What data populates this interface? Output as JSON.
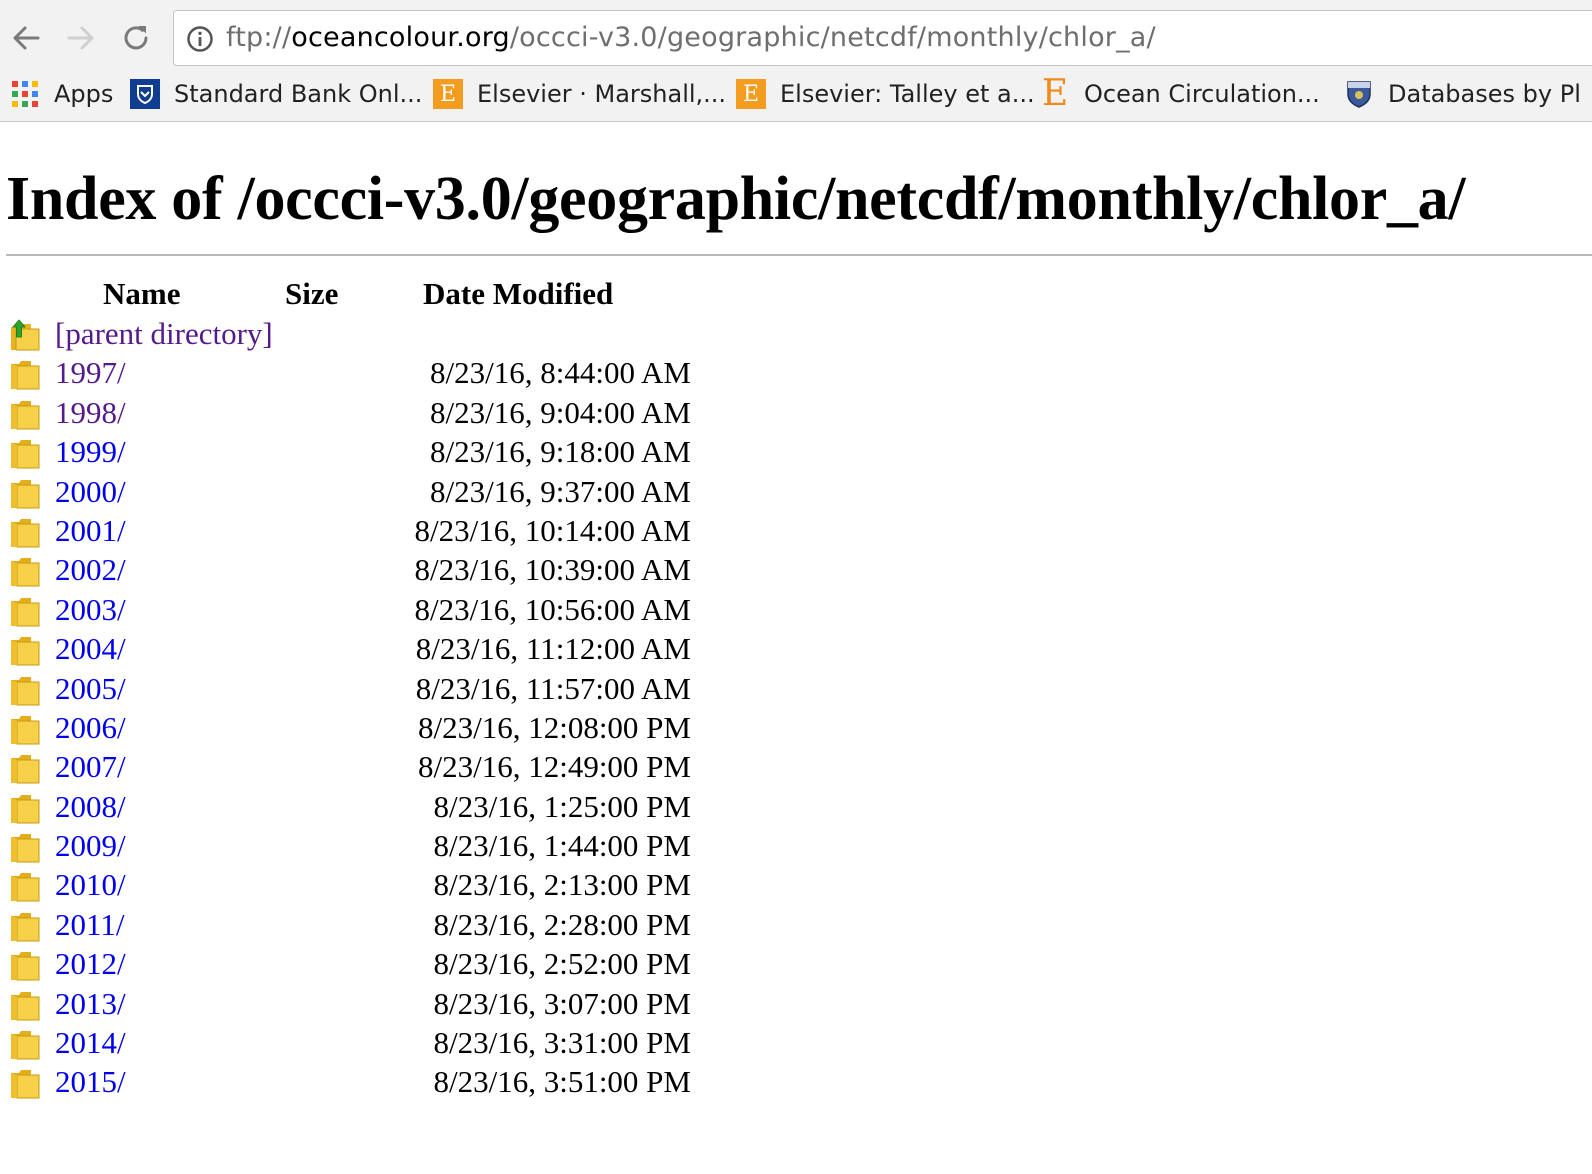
{
  "browser": {
    "url": {
      "scheme": "ftp://",
      "host": "oceancolour.org",
      "path": "/occci-v3.0/geographic/netcdf/monthly/chlor_a/"
    },
    "bookmarks": [
      {
        "label": "Apps",
        "icon": "apps-grid-icon"
      },
      {
        "label": "Standard Bank Onl...",
        "icon": "standard-bank-shield-icon"
      },
      {
        "label": "Elsevier · Marshall,...",
        "icon": "elsevier-e-icon"
      },
      {
        "label": "Elsevier: Talley et a...",
        "icon": "elsevier-e-icon"
      },
      {
        "label": "Ocean Circulation...",
        "icon": "elsevier-e-plain-icon"
      },
      {
        "label": "Databases by Pl",
        "icon": "university-crest-icon"
      }
    ]
  },
  "page": {
    "heading": "Index of /occci-v3.0/geographic/netcdf/monthly/chlor_a/",
    "columns": {
      "name": "Name",
      "size": "Size",
      "date": "Date Modified"
    },
    "parent_link": "[parent directory]",
    "entries": [
      {
        "name": "1997/",
        "date": "8/23/16, 8:44:00 AM",
        "visited": true
      },
      {
        "name": "1998/",
        "date": "8/23/16, 9:04:00 AM",
        "visited": true
      },
      {
        "name": "1999/",
        "date": "8/23/16, 9:18:00 AM",
        "visited": false
      },
      {
        "name": "2000/",
        "date": "8/23/16, 9:37:00 AM",
        "visited": false
      },
      {
        "name": "2001/",
        "date": "8/23/16, 10:14:00 AM",
        "visited": false
      },
      {
        "name": "2002/",
        "date": "8/23/16, 10:39:00 AM",
        "visited": false
      },
      {
        "name": "2003/",
        "date": "8/23/16, 10:56:00 AM",
        "visited": false
      },
      {
        "name": "2004/",
        "date": "8/23/16, 11:12:00 AM",
        "visited": false
      },
      {
        "name": "2005/",
        "date": "8/23/16, 11:57:00 AM",
        "visited": false
      },
      {
        "name": "2006/",
        "date": "8/23/16, 12:08:00 PM",
        "visited": false
      },
      {
        "name": "2007/",
        "date": "8/23/16, 12:49:00 PM",
        "visited": false
      },
      {
        "name": "2008/",
        "date": "8/23/16, 1:25:00 PM",
        "visited": false
      },
      {
        "name": "2009/",
        "date": "8/23/16, 1:44:00 PM",
        "visited": false
      },
      {
        "name": "2010/",
        "date": "8/23/16, 2:13:00 PM",
        "visited": false
      },
      {
        "name": "2011/",
        "date": "8/23/16, 2:28:00 PM",
        "visited": false
      },
      {
        "name": "2012/",
        "date": "8/23/16, 2:52:00 PM",
        "visited": false
      },
      {
        "name": "2013/",
        "date": "8/23/16, 3:07:00 PM",
        "visited": false
      },
      {
        "name": "2014/",
        "date": "8/23/16, 3:31:00 PM",
        "visited": false
      },
      {
        "name": "2015/",
        "date": "8/23/16, 3:51:00 PM",
        "visited": false
      }
    ]
  },
  "colors": {
    "link": "#0000ee",
    "visited_link": "#551a8b",
    "folder_fill": "#f7d04a",
    "parent_arrow": "#2aa52a"
  }
}
